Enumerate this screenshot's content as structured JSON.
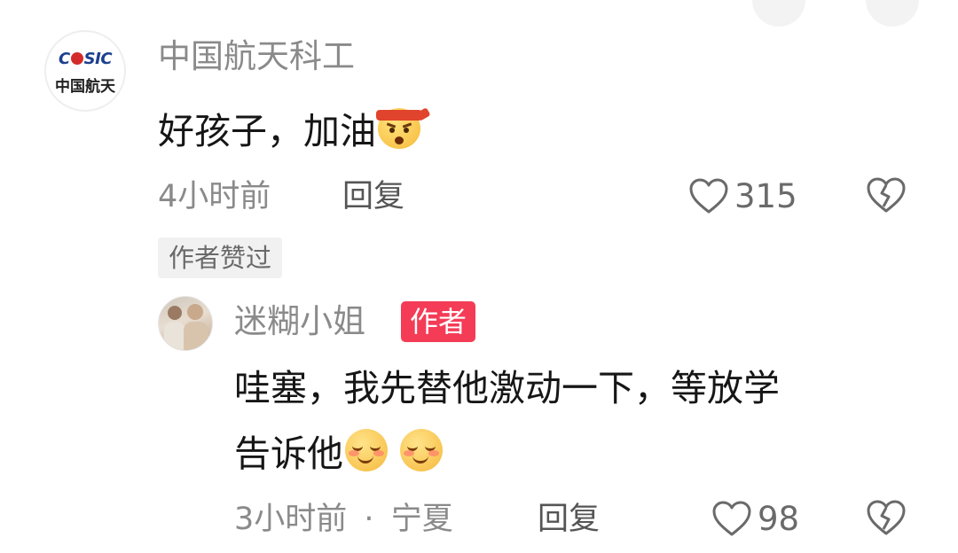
{
  "comment1": {
    "author": "中国航天科工",
    "avatar_logo_text": "CASIC",
    "avatar_logo_cn": "中国航天",
    "text": "好孩子，加油",
    "emoji": "fighting-emoji",
    "time": "4小时前",
    "reply_label": "回复",
    "like_count": "315",
    "author_liked_tag": "作者赞过"
  },
  "comment2": {
    "author": "迷糊小姐",
    "author_badge": "作者",
    "text_line1": "哇塞，我先替他激动一下，等放学",
    "text_line2": "告诉他",
    "emoji": "shy-smile-emoji",
    "time": "3小时前",
    "separator": "·",
    "location": "宁夏",
    "reply_label": "回复",
    "like_count": "98"
  },
  "colors": {
    "badge": "#f43c57",
    "meta_gray": "#8a8a8a",
    "text": "#161616"
  }
}
